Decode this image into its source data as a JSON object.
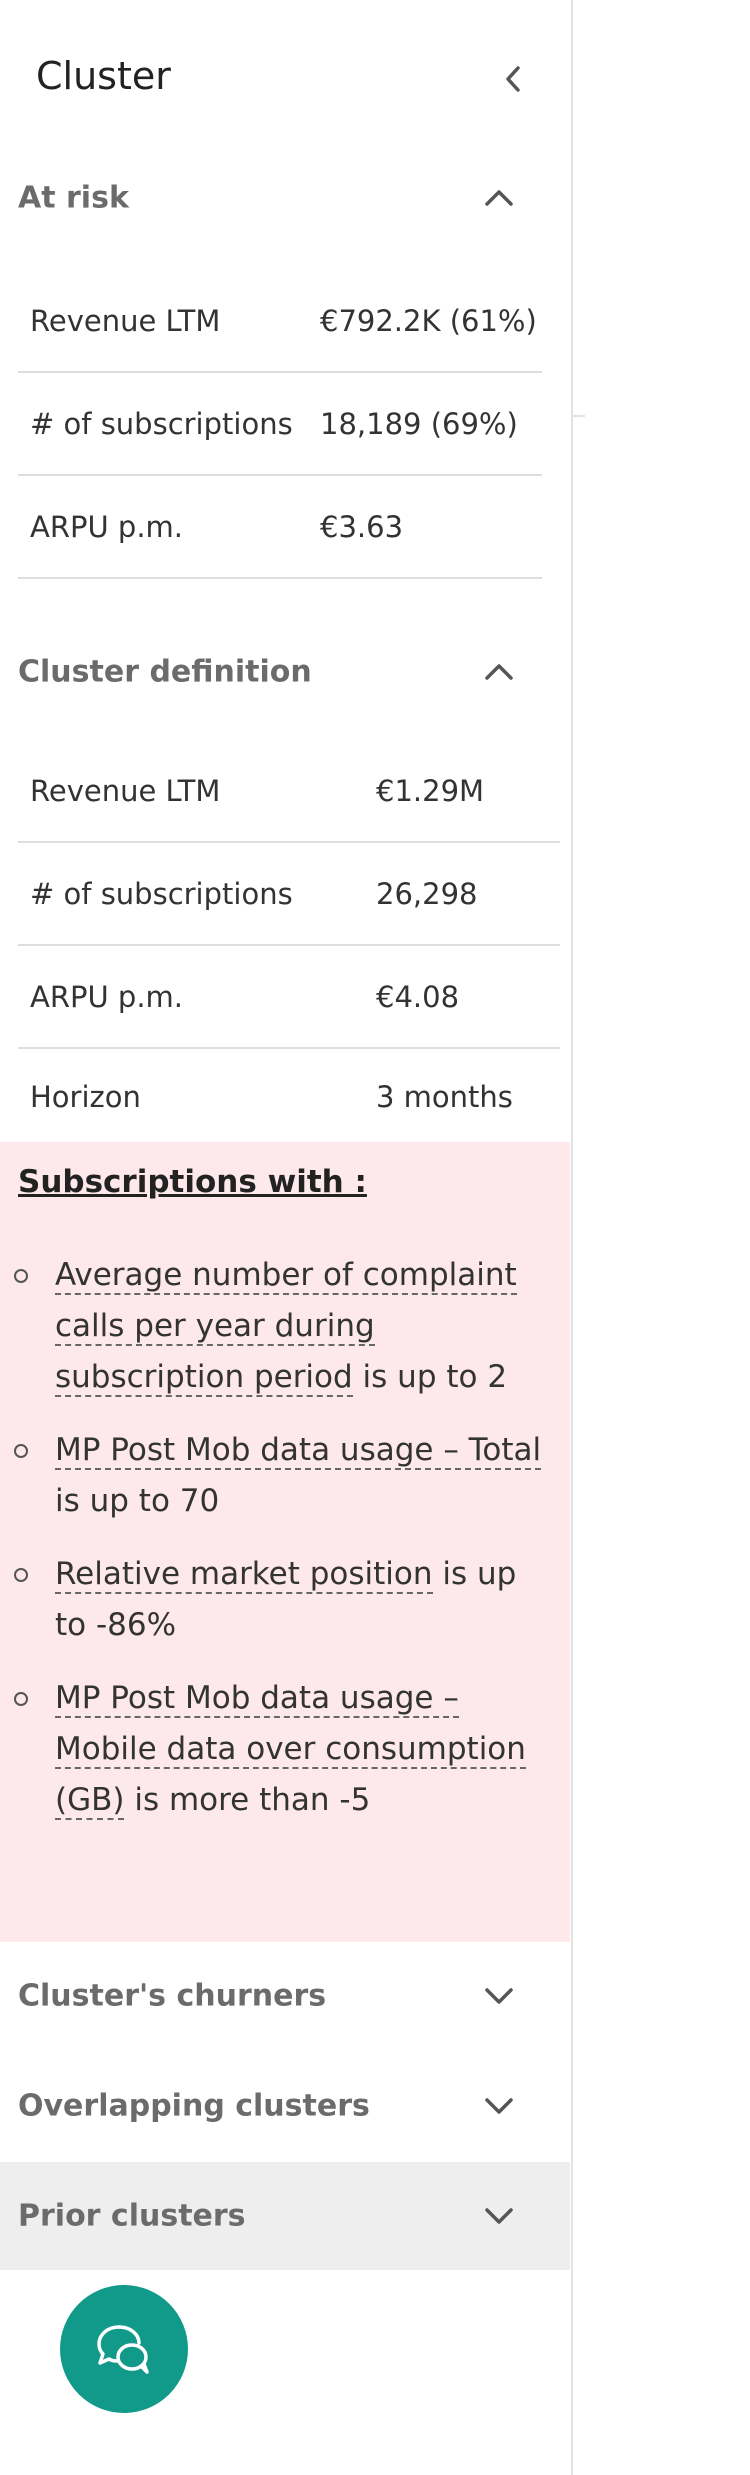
{
  "panel": {
    "title": "Cluster"
  },
  "at_risk": {
    "title": "At risk",
    "rows": [
      {
        "label": "Revenue LTM",
        "value": "€792.2K (61%)"
      },
      {
        "label": "# of subscriptions",
        "value": "18,189 (69%)"
      },
      {
        "label": "ARPU p.m.",
        "value": "€3.63"
      }
    ]
  },
  "cluster_definition": {
    "title": "Cluster definition",
    "rows": [
      {
        "label": "Revenue LTM",
        "value": "€1.29M"
      },
      {
        "label": "# of subscriptions",
        "value": "26,298"
      },
      {
        "label": "ARPU p.m.",
        "value": "€4.08"
      },
      {
        "label": "Horizon",
        "value": "3 months"
      }
    ]
  },
  "conditions": {
    "title": "Subscriptions with :",
    "items": [
      {
        "term": "Average number of complaint calls per year during subscription period",
        "rest": " is up to 2"
      },
      {
        "term": "MP Post Mob data usage – Total",
        "rest": " is up to 70"
      },
      {
        "term": "Relative market position",
        "rest": " is up to -86%"
      },
      {
        "term": "MP Post Mob data usage – Mobile data over consumption (GB)",
        "rest": " is more than -5"
      }
    ]
  },
  "sections": {
    "churners": "Cluster's churners",
    "overlapping": "Overlapping clusters",
    "prior": "Prior clusters"
  },
  "icons": {
    "collapse": "chevron-left-icon",
    "expanded": "chevron-up-icon",
    "collapsed": "chevron-down-icon",
    "chat": "chat-bubbles-icon"
  },
  "colors": {
    "conditions_background": "#fde8eb",
    "prior_header_background": "#eeeeee",
    "chat_button": "#119a8a"
  }
}
